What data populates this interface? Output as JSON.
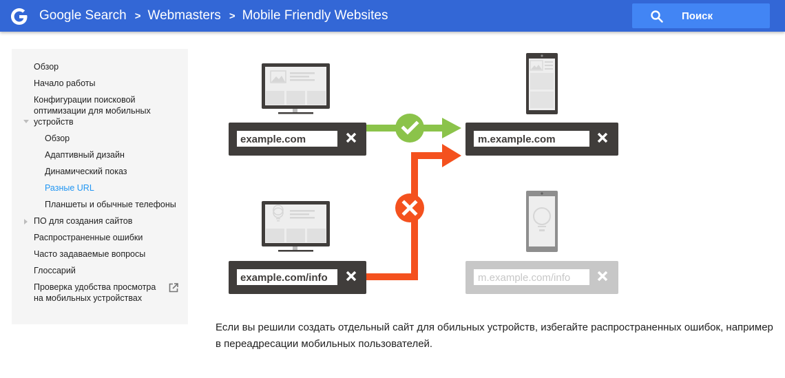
{
  "header": {
    "logo": "google-g-logo",
    "breadcrumbs": [
      "Google Search",
      "Webmasters",
      "Mobile Friendly Websites"
    ],
    "separator_icon": "chevron-right-icon",
    "search_button": {
      "icon": "search-icon",
      "label": "Поиск"
    },
    "colors": {
      "bar": "#3367d6",
      "search_bg": "#4285f4"
    }
  },
  "sidebar": {
    "items": [
      {
        "label": "Обзор",
        "level": 1
      },
      {
        "label": "Начало работы",
        "level": 1
      },
      {
        "label": "Конфигурации поисковой оптимизации для мобильных устройств",
        "level": 1,
        "expanded": true
      },
      {
        "label": "Обзор",
        "level": 2
      },
      {
        "label": "Адаптивный дизайн",
        "level": 2
      },
      {
        "label": "Динамический показ",
        "level": 2
      },
      {
        "label": "Разные URL",
        "level": 2,
        "active": true
      },
      {
        "label": "Планшеты и обычные телефоны",
        "level": 2
      },
      {
        "label": "ПО для создания сайтов",
        "level": 1,
        "collapsed": true
      },
      {
        "label": "Распространенные ошибки",
        "level": 1
      },
      {
        "label": "Часто задаваемые вопросы",
        "level": 1
      },
      {
        "label": "Глоссарий",
        "level": 1
      },
      {
        "label": "Проверка удобства просмотра на мобильных устройствах",
        "level": 1,
        "external": true
      }
    ],
    "active_color": "#2196f3"
  },
  "diagram": {
    "desktop_urls": [
      "example.com",
      "example.com/info"
    ],
    "mobile_urls": [
      "m.example.com",
      "m.example.com/info"
    ],
    "correct_redirect": {
      "icon": "checkmark-icon",
      "color": "#8bc34a"
    },
    "wrong_redirect": {
      "icon": "cross-icon",
      "color": "#f4511e"
    },
    "bar_color": "#403d3b",
    "disabled_color": "#c7c7c7"
  },
  "caption": "Если вы решили создать отдельный сайт для обильных устройств, избегайте распространенных ошибок, например в переадресации мобильных пользователей."
}
